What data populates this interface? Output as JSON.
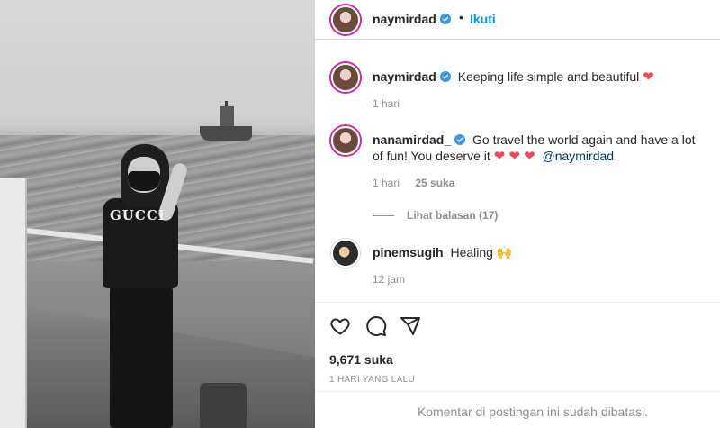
{
  "post": {
    "author": "naymirdad",
    "follow_separator": "•",
    "follow_label": "Ikuti",
    "caption": {
      "username": "naymirdad",
      "text": "Keeping life simple and beautiful",
      "emoji": "❤",
      "time": "1 hari"
    },
    "comments": [
      {
        "username": "nanamirdad_",
        "text": "Go travel the world again and have a lot of fun! You deserve it",
        "emoji": "❤ ❤ ❤",
        "mention": "@naymirdad",
        "time": "1 hari",
        "likes": "25 suka",
        "replies": "Lihat balasan (17)"
      },
      {
        "username": "pinemsugih",
        "text": "Healing",
        "emoji": "🙌",
        "time": "12 jam"
      }
    ],
    "like_count": "9,671 suka",
    "timestamp": "1 HARI YANG LALU",
    "comments_limited": "Komentar di postingan ini sudah dibatasi."
  },
  "photo": {
    "shirt_text": "GUCCI"
  },
  "colors": {
    "accent": "#0095f6",
    "verified": "#3897f0",
    "heart": "#ed4956",
    "muted": "#8e8e8e"
  },
  "icons": [
    "verified-badge-icon",
    "heart-icon",
    "comment-icon",
    "share-icon"
  ]
}
